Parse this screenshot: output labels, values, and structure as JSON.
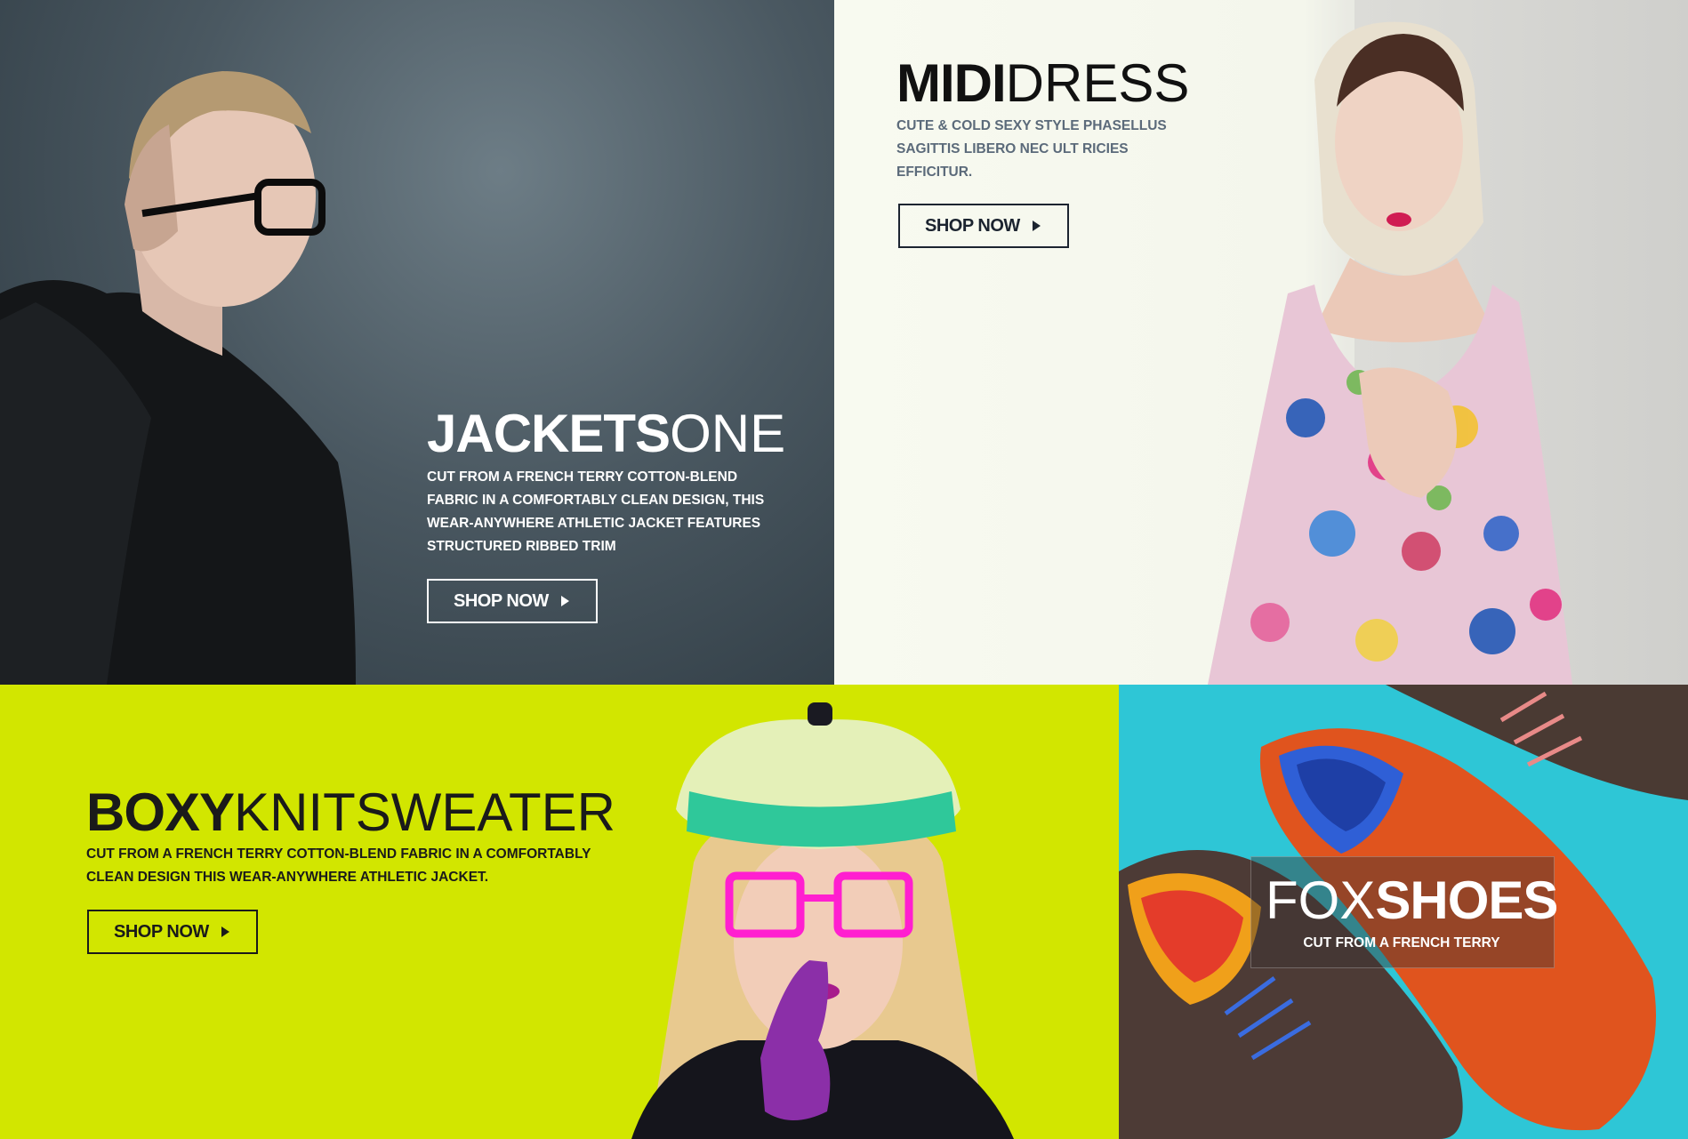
{
  "jackets": {
    "title_strong": "JACKETS",
    "title_light": "ONE",
    "description": "CUT FROM A FRENCH TERRY COTTON-BLEND FABRIC IN A COMFORTABLY CLEAN DESIGN, THIS WEAR-ANYWHERE ATHLETIC JACKET FEATURES STRUCTURED RIBBED TRIM",
    "button_label": "SHOP NOW"
  },
  "midi": {
    "title_strong": "MIDI",
    "title_light": "DRESS",
    "description": "CUTE & COLD SEXY STYLE PHASELLUS SAGITTIS LIBERO NEC ULT RICIES EFFICITUR.",
    "button_label": "SHOP NOW"
  },
  "boxy": {
    "title_strong": "BOXY",
    "title_light": "KNITSWEATER",
    "description": "CUT FROM A FRENCH TERRY COTTON-BLEND FABRIC IN A COMFORTABLY CLEAN DESIGN THIS WEAR-ANYWHERE ATHLETIC JACKET.",
    "button_label": "SHOP NOW"
  },
  "fox": {
    "title_light": "FOX",
    "title_strong": "SHOES",
    "description": "CUT FROM A FRENCH TERRY"
  },
  "colors": {
    "boxy_background": "#d2e600",
    "fox_background": "#2ec6d6",
    "jackets_background": "#4a5861",
    "midi_background": "#f6f8ee"
  }
}
